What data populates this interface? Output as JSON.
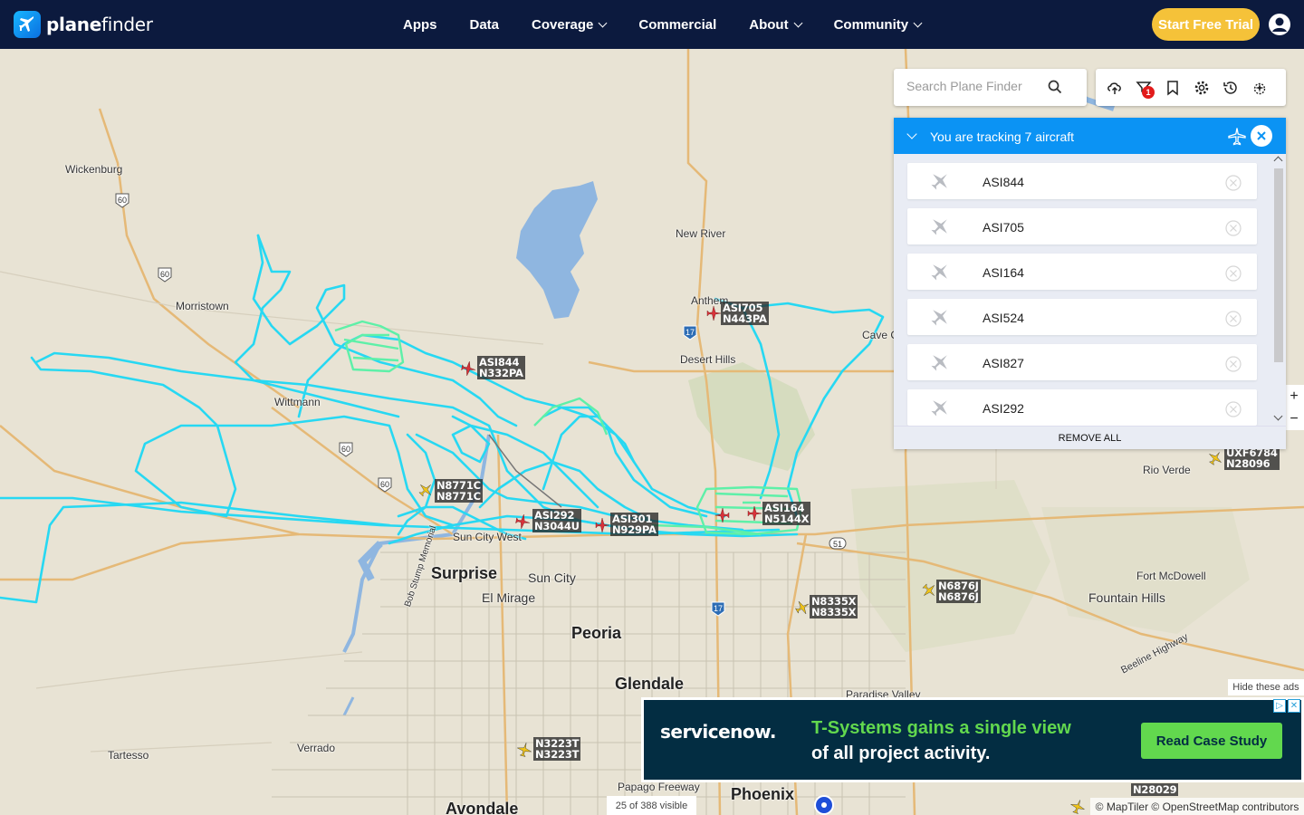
{
  "header": {
    "logo_text_bold": "plane",
    "logo_text_light": "finder",
    "nav": [
      {
        "label": "Apps",
        "dropdown": false
      },
      {
        "label": "Data",
        "dropdown": false
      },
      {
        "label": "Coverage",
        "dropdown": true
      },
      {
        "label": "Commercial",
        "dropdown": false
      },
      {
        "label": "About",
        "dropdown": true
      },
      {
        "label": "Community",
        "dropdown": true
      }
    ],
    "cta_label": "Start Free Trial"
  },
  "search": {
    "placeholder": "Search Plane Finder"
  },
  "toolbar": {
    "filter_badge": "1"
  },
  "tracking": {
    "title": "You are tracking 7 aircraft",
    "items": [
      "ASI844",
      "ASI705",
      "ASI164",
      "ASI524",
      "ASI827",
      "ASI292"
    ],
    "remove_all_label": "REMOVE ALL"
  },
  "map": {
    "places": [
      {
        "name": "Wickenburg",
        "size": "small"
      },
      {
        "name": "Morristown",
        "size": "small"
      },
      {
        "name": "Wittmann",
        "size": "small"
      },
      {
        "name": "New River",
        "size": "small"
      },
      {
        "name": "Anthem",
        "size": "small"
      },
      {
        "name": "Desert Hills",
        "size": "small"
      },
      {
        "name": "Cave C",
        "size": "small"
      },
      {
        "name": "Rio Verde",
        "size": "small"
      },
      {
        "name": "Surprise",
        "size": "big"
      },
      {
        "name": "Sun City",
        "size": "mid"
      },
      {
        "name": "El Mirage",
        "size": "mid"
      },
      {
        "name": "Sun City West",
        "size": "small"
      },
      {
        "name": "Peoria",
        "size": "big"
      },
      {
        "name": "Glendale",
        "size": "big"
      },
      {
        "name": "Phoenix",
        "size": "big"
      },
      {
        "name": "Avondale",
        "size": "big"
      },
      {
        "name": "Fort McDowell",
        "size": "small"
      },
      {
        "name": "Fountain Hills",
        "size": "mid"
      },
      {
        "name": "Paradise Valley",
        "size": "small"
      },
      {
        "name": "Tartesso",
        "size": "small"
      },
      {
        "name": "Verrado",
        "size": "small"
      },
      {
        "name": "Papago Freeway",
        "size": "small"
      },
      {
        "name": "Bob Stump Memorial",
        "size": "small"
      },
      {
        "name": "Beeline Highway",
        "size": "small"
      }
    ],
    "shields": [
      "60",
      "60",
      "60",
      "60",
      "17",
      "17",
      "51"
    ],
    "aircraft": [
      {
        "callsign": "ASI705",
        "reg": "N443PA",
        "tracked": true
      },
      {
        "callsign": "ASI844",
        "reg": "N332PA",
        "tracked": true
      },
      {
        "callsign": "N8771C",
        "reg": "N8771C",
        "tracked": false
      },
      {
        "callsign": "ASI292",
        "reg": "N3044U",
        "tracked": true
      },
      {
        "callsign": "ASI301",
        "reg": "N929PA",
        "tracked": true
      },
      {
        "callsign": "ASI164",
        "reg": "N5144X",
        "tracked": true
      },
      {
        "callsign": "UXF6784",
        "reg": "N28096",
        "tracked": false
      },
      {
        "callsign": "N6876J",
        "reg": "N6876J",
        "tracked": false
      },
      {
        "callsign": "N8335X",
        "reg": "N8335X",
        "tracked": false
      },
      {
        "callsign": "N3223T",
        "reg": "N3223T",
        "tracked": false
      },
      {
        "callsign": "",
        "reg": "N28029",
        "tracked": false
      }
    ],
    "visible_count": "25 of 388 visible",
    "attribution": "© MapTiler © OpenStreetMap contributors",
    "zoom_in": "+",
    "zoom_out": "−"
  },
  "ad": {
    "hide_label": "Hide these ads",
    "brand": "servicenow.",
    "headline_line1": "T-Systems gains a single view",
    "headline_line2": "of all project activity.",
    "cta": "Read Case Study"
  },
  "colors": {
    "header_bg": "#0c1a3e",
    "cta_bg": "#f5c239",
    "panel_header": "#0b93f4",
    "track_line": "#27d8f2",
    "track_line_green": "#5ef0a8",
    "tracked_aircraft": "#d9323a",
    "other_aircraft": "#f0c419",
    "ad_bg": "#032d42",
    "ad_accent": "#62d84e"
  }
}
